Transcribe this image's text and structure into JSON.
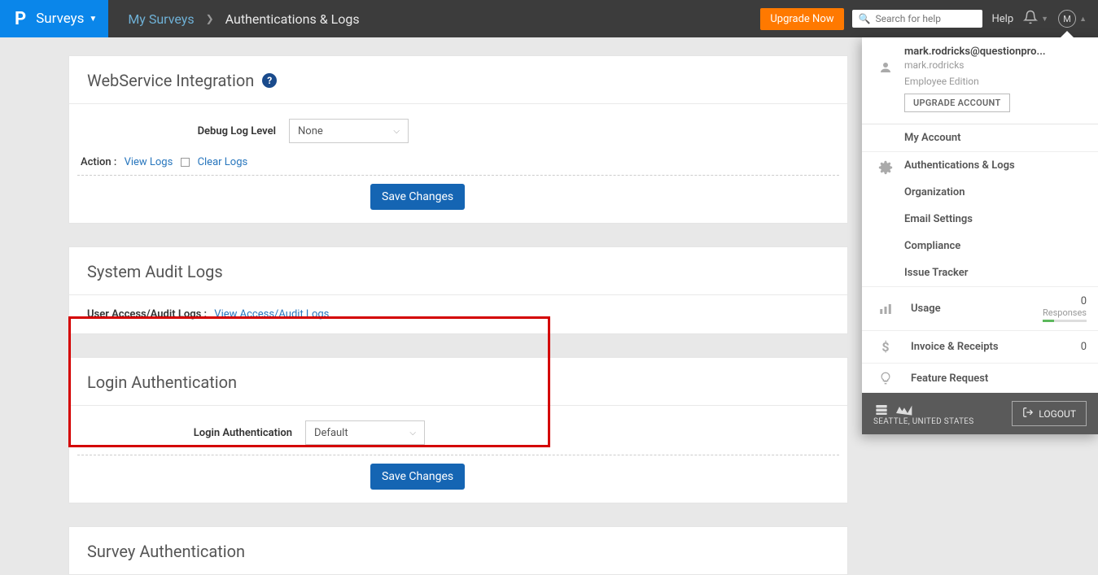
{
  "topbar": {
    "brand_logo": "P",
    "brand_text": "Surveys",
    "breadcrumb_my": "My Surveys",
    "breadcrumb_chev": "❯",
    "breadcrumb_current": "Authentications & Logs",
    "upgrade": "Upgrade Now",
    "search_placeholder": "Search for help",
    "help": "Help",
    "avatar": "M"
  },
  "card1": {
    "title": "WebService Integration",
    "label": "Debug Log Level",
    "select_value": "None",
    "action_label": "Action :",
    "view_logs": "View Logs",
    "clear_logs": "Clear Logs",
    "save": "Save Changes"
  },
  "card2": {
    "title": "System Audit Logs",
    "label": "User Access/Audit Logs :",
    "link": "View Access/Audit Logs"
  },
  "card3": {
    "title": "Login Authentication",
    "label": "Login Authentication",
    "select_value": "Default",
    "save": "Save Changes"
  },
  "card4": {
    "title": "Survey Authentication"
  },
  "panel": {
    "email": "mark.rodricks@questionpro...",
    "username": "mark.rodricks",
    "edition": "Employee Edition",
    "upgrade": "UPGRADE ACCOUNT",
    "my_account": "My Account",
    "auth_logs": "Authentications & Logs",
    "organization": "Organization",
    "email_settings": "Email Settings",
    "compliance": "Compliance",
    "issue_tracker": "Issue Tracker",
    "usage": "Usage",
    "usage_num": "0",
    "usage_sub": "Responses",
    "invoice": "Invoice & Receipts",
    "invoice_val": "0",
    "feature": "Feature Request",
    "location": "SEATTLE, UNITED STATES",
    "logout": "LOGOUT"
  }
}
